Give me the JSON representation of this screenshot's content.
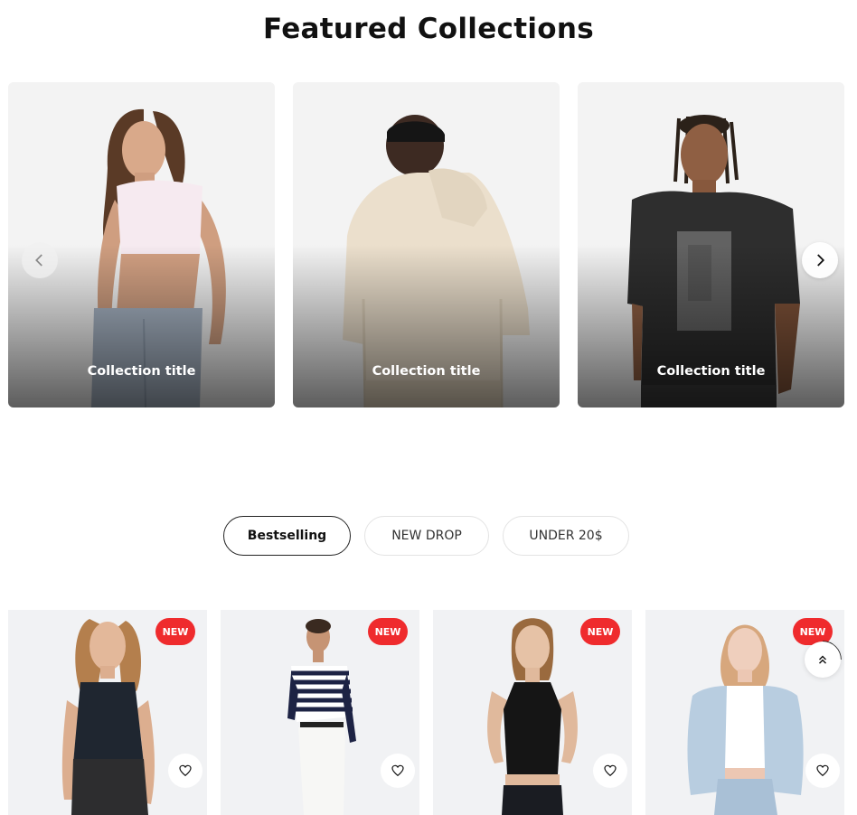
{
  "featured": {
    "title": "Featured Collections",
    "cards": [
      {
        "title": "Collection title"
      },
      {
        "title": "Collection title"
      },
      {
        "title": "Collection title"
      }
    ],
    "prev_icon": "chevron-left-icon",
    "next_icon": "chevron-right-icon"
  },
  "tabs": [
    {
      "label": "Bestselling",
      "active": true
    },
    {
      "label": "NEW DROP",
      "active": false
    },
    {
      "label": "UNDER 20$",
      "active": false
    }
  ],
  "products": [
    {
      "badge": "NEW",
      "wishlist_icon": "heart-icon"
    },
    {
      "badge": "NEW",
      "wishlist_icon": "heart-icon"
    },
    {
      "badge": "NEW",
      "wishlist_icon": "heart-icon"
    },
    {
      "badge": "NEW",
      "wishlist_icon": "heart-icon"
    }
  ],
  "scroll_top_icon": "double-chevron-up-icon",
  "colors": {
    "badge": "#ef2b2d",
    "card_bg": "#f3f3f3",
    "product_bg": "#f1f2f4",
    "text": "#111111"
  }
}
